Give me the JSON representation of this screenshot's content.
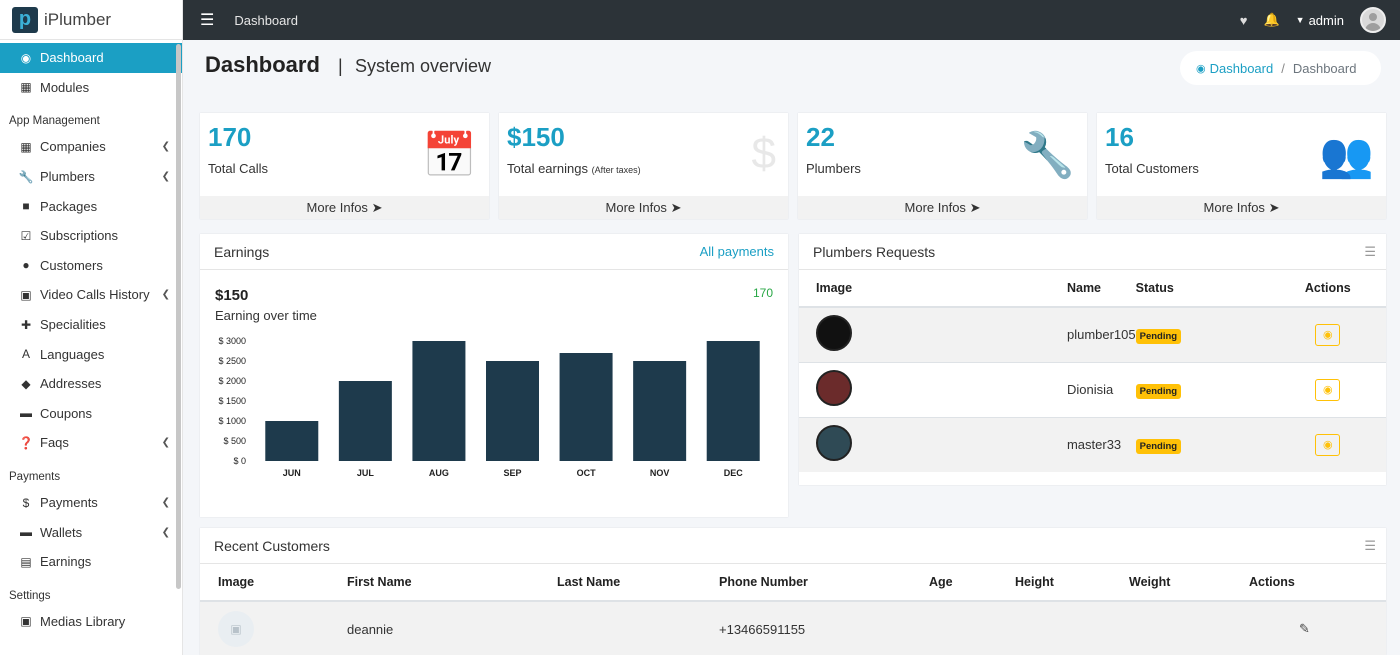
{
  "brand": {
    "name": "iPlumber"
  },
  "topbar": {
    "title": "Dashboard",
    "user": "admin"
  },
  "sidebar": {
    "items": [
      {
        "label": "Dashboard",
        "icon": "dashboard-icon",
        "active": true
      },
      {
        "label": "Modules",
        "icon": "grid-icon"
      }
    ],
    "section_app": "App Management",
    "app_items": [
      {
        "label": "Companies",
        "icon": "building-icon",
        "chev": true
      },
      {
        "label": "Plumbers",
        "icon": "wrench-icon",
        "chev": true
      },
      {
        "label": "Packages",
        "icon": "box-icon"
      },
      {
        "label": "Subscriptions",
        "icon": "calendar-check-icon"
      },
      {
        "label": "Customers",
        "icon": "user-icon"
      },
      {
        "label": "Video Calls History",
        "icon": "calendar-icon",
        "chev": true
      },
      {
        "label": "Specialities",
        "icon": "medkit-icon"
      },
      {
        "label": "Languages",
        "icon": "language-icon"
      },
      {
        "label": "Addresses",
        "icon": "map-icon"
      },
      {
        "label": "Coupons",
        "icon": "ticket-icon"
      },
      {
        "label": "Faqs",
        "icon": "question-icon",
        "chev": true
      }
    ],
    "section_payments": "Payments",
    "pay_items": [
      {
        "label": "Payments",
        "icon": "money-icon",
        "chev": true
      },
      {
        "label": "Wallets",
        "icon": "wallet-icon",
        "chev": true
      },
      {
        "label": "Earnings",
        "icon": "cash-icon"
      }
    ],
    "section_settings": "Settings",
    "settings_items": [
      {
        "label": "Medias Library",
        "icon": "photo-icon"
      }
    ]
  },
  "header": {
    "title": "Dashboard",
    "separator": "|",
    "subtitle": "System overview"
  },
  "breadcrumb": {
    "link": "Dashboard",
    "separator": "/",
    "current": "Dashboard"
  },
  "stats": [
    {
      "value": "170",
      "label": "Total Calls",
      "note": "",
      "more": "More Infos",
      "icon": "calendar-check-icon"
    },
    {
      "value": "$150",
      "label": "Total earnings",
      "note": "(After taxes)",
      "more": "More Infos",
      "icon": "hand-dollar-icon"
    },
    {
      "value": "22",
      "label": "Plumbers",
      "note": "",
      "more": "More Infos",
      "icon": "wrench-icon"
    },
    {
      "value": "16",
      "label": "Total Customers",
      "note": "",
      "more": "More Infos",
      "icon": "users-icon"
    }
  ],
  "earnings": {
    "title": "Earnings",
    "link": "All payments",
    "value": "$150",
    "subtitle": "Earning over time",
    "count": "170"
  },
  "chart_data": {
    "type": "bar",
    "categories": [
      "JUN",
      "JUL",
      "AUG",
      "SEP",
      "OCT",
      "NOV",
      "DEC"
    ],
    "values": [
      1000,
      2000,
      3000,
      2500,
      2700,
      2500,
      3000
    ],
    "yticks": [
      "$ 0",
      "$ 500",
      "$ 1000",
      "$ 1500",
      "$ 2000",
      "$ 2500",
      "$ 3000"
    ],
    "ylim": [
      0,
      3000
    ],
    "color": "#1e3a4c"
  },
  "plumbers": {
    "title": "Plumbers Requests",
    "headers": [
      "Image",
      "Name",
      "Status",
      "Actions"
    ],
    "rows": [
      {
        "name": "plumber105",
        "status": "Pending"
      },
      {
        "name": "Dionisia",
        "status": "Pending"
      },
      {
        "name": "master33",
        "status": "Pending"
      }
    ]
  },
  "customers": {
    "title": "Recent Customers",
    "headers": [
      "Image",
      "First Name",
      "Last Name",
      "Phone Number",
      "Age",
      "Height",
      "Weight",
      "Actions"
    ],
    "rows": [
      {
        "first": "deannie",
        "last": "",
        "phone": "+13466591155",
        "age": "",
        "height": "",
        "weight": ""
      }
    ]
  }
}
